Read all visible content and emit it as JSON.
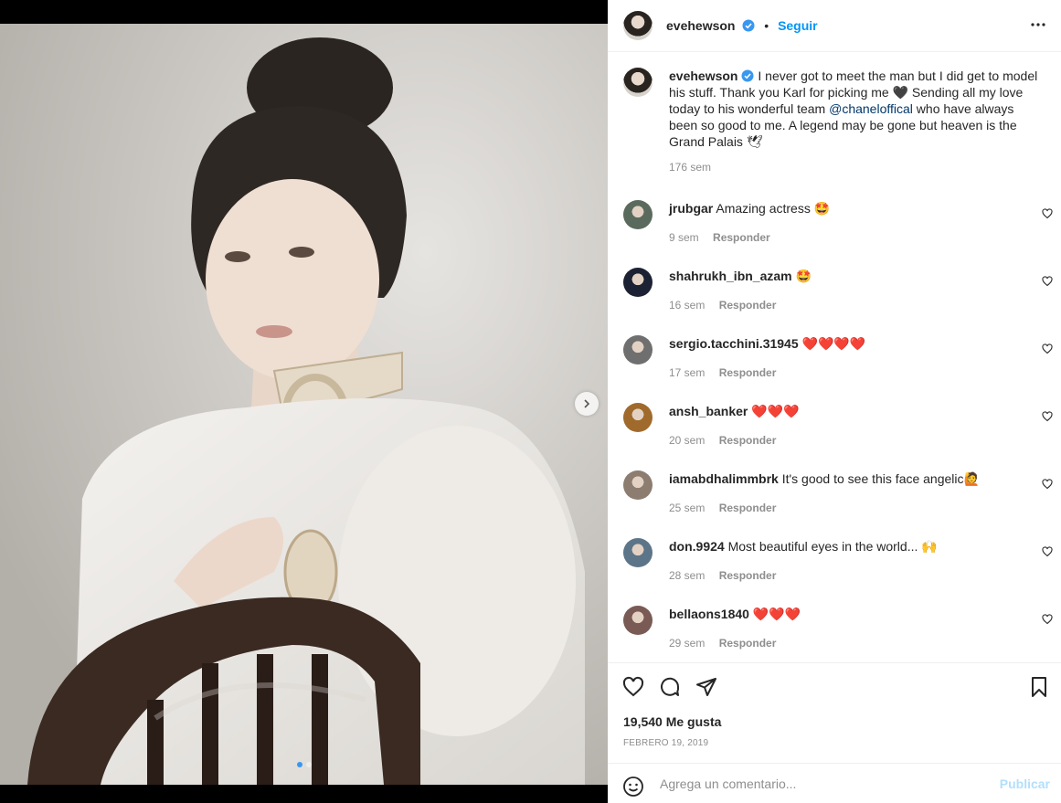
{
  "post": {
    "username": "evehewson",
    "follow_label": "Seguir",
    "separator": "•",
    "caption_pre": "I never got to meet the man but I did get to model his stuff. Thank you Karl for picking me 🖤 Sending all my love today to his wonderful team ",
    "caption_mention": "@chaneloffical",
    "caption_post": " who have always been so good to me. A legend may be gone but heaven is the Grand Palais 🕊",
    "caption_time": "176 sem",
    "likes": "19,540 Me gusta",
    "date": "FEBRERO 19, 2019"
  },
  "comments": [
    {
      "user": "jrubgar",
      "text": "Amazing actress 🤩",
      "time": "9 sem",
      "reply": "Responder",
      "avatar_color": "#5a6b5e"
    },
    {
      "user": "shahrukh_ibn_azam",
      "text": "🤩",
      "time": "16 sem",
      "reply": "Responder",
      "avatar_color": "#1c2233"
    },
    {
      "user": "sergio.tacchini.31945",
      "text": "❤️❤️❤️❤️",
      "time": "17 sem",
      "reply": "Responder",
      "avatar_color": "#6f6f6f"
    },
    {
      "user": "ansh_banker",
      "text": "❤️❤️❤️",
      "time": "20 sem",
      "reply": "Responder",
      "avatar_color": "#a06a2c"
    },
    {
      "user": "iamabdhalimmbrk",
      "text": "It's good to see this face angelic🙋",
      "time": "25 sem",
      "reply": "Responder",
      "avatar_color": "#8c7d70"
    },
    {
      "user": "don.9924",
      "text": "Most beautiful eyes in the world... 🙌",
      "time": "28 sem",
      "reply": "Responder",
      "avatar_color": "#5d7588"
    },
    {
      "user": "bellaons1840",
      "text": "❤️❤️❤️",
      "time": "29 sem",
      "reply": "Responder",
      "avatar_color": "#7a5a55"
    }
  ],
  "input": {
    "placeholder": "Agrega un comentario...",
    "publish_label": "Publicar"
  },
  "colors": {
    "accent": "#0095f6",
    "mention": "#00376b",
    "muted": "#8e8e8e",
    "publish_disabled": "#b2dffc"
  },
  "icons": [
    "verified-badge-icon",
    "more-options-icon",
    "heart-icon",
    "comment-icon",
    "share-icon",
    "bookmark-icon",
    "emoji-icon",
    "chevron-right-icon"
  ]
}
